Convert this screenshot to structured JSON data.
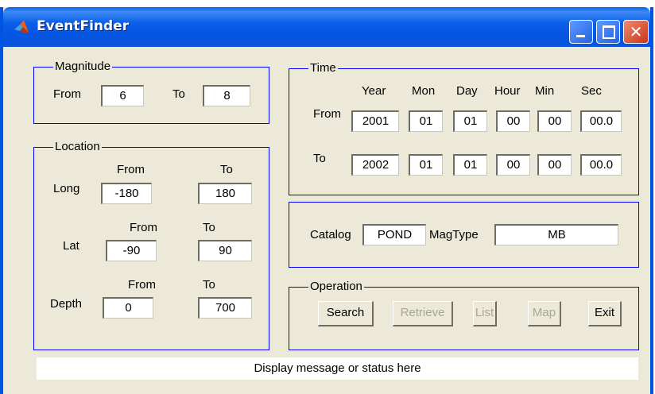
{
  "window": {
    "title": "EventFinder"
  },
  "magnitude": {
    "title": "Magnitude",
    "from_label": "From",
    "from_value": "6",
    "to_label": "To",
    "to_value": "8"
  },
  "location": {
    "title": "Location",
    "long": {
      "label": "Long",
      "from_header": "From",
      "to_header": "To",
      "from_value": "-180",
      "to_value": "180"
    },
    "lat": {
      "label": "Lat",
      "from_header": "From",
      "to_header": "To",
      "from_value": "-90",
      "to_value": "90"
    },
    "depth": {
      "label": "Depth",
      "from_header": "From",
      "to_header": "To",
      "from_value": "0",
      "to_value": "700"
    }
  },
  "time": {
    "title": "Time",
    "headers": {
      "year": "Year",
      "mon": "Mon",
      "day": "Day",
      "hour": "Hour",
      "min": "Min",
      "sec": "Sec"
    },
    "from": {
      "label": "From",
      "year": "2001",
      "mon": "01",
      "day": "01",
      "hour": "00",
      "min": "00",
      "sec": "00.0"
    },
    "to": {
      "label": "To",
      "year": "2002",
      "mon": "01",
      "day": "01",
      "hour": "00",
      "min": "00",
      "sec": "00.0"
    }
  },
  "catalog": {
    "label": "Catalog",
    "value": "POND",
    "magtype_label": "MagType",
    "magtype_value": "MB"
  },
  "operation": {
    "title": "Operation",
    "search": "Search",
    "retrieve": "Retrieve",
    "list": "List",
    "map": "Map",
    "exit": "Exit"
  },
  "status": {
    "message": "Display message or status here"
  },
  "colors": {
    "group_border": "#0000ff",
    "titlebar": "#0a5fe8",
    "panel": "#ece9d8",
    "disabled_text": "#a7a699"
  },
  "icons": {
    "app": "matlab-icon",
    "minimize": "minimize-icon",
    "maximize": "maximize-icon",
    "close": "close-icon"
  }
}
